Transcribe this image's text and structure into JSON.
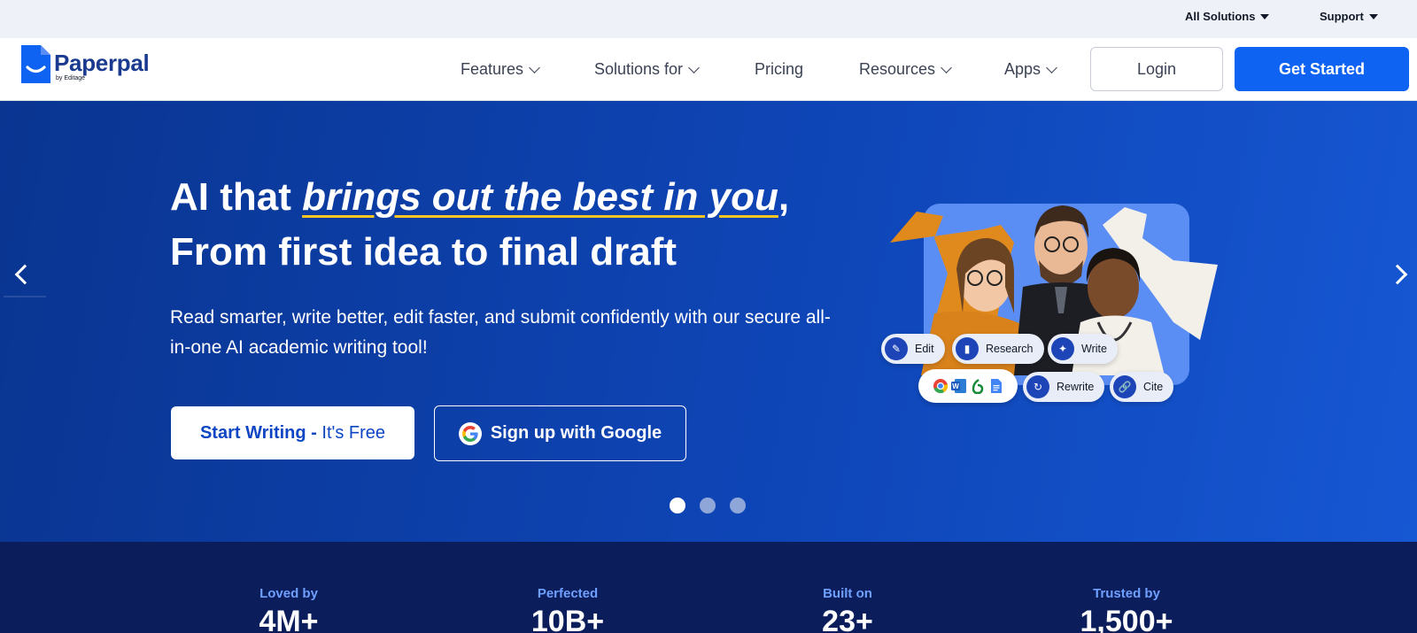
{
  "topbar": {
    "all_solutions": "All Solutions",
    "support": "Support"
  },
  "brand": {
    "name": "Paperpal",
    "byline": "by Editage",
    "color": "#1a3a8f"
  },
  "nav": {
    "items": [
      {
        "label": "Features",
        "has_dropdown": true
      },
      {
        "label": "Solutions for",
        "has_dropdown": true
      },
      {
        "label": "Pricing",
        "has_dropdown": false
      },
      {
        "label": "Resources",
        "has_dropdown": true
      },
      {
        "label": "Apps",
        "has_dropdown": true
      }
    ],
    "login_label": "Login",
    "get_started_label": "Get Started"
  },
  "hero": {
    "headline_prefix": "AI that ",
    "headline_emphasis": "brings out the best in you",
    "headline_suffix": ",",
    "headline_line2": "From first idea to final draft",
    "subtext": "Read smarter, write better, edit faster, and submit confidently with our secure all-in-one AI academic writing tool!",
    "cta_primary_main": "Start Writing - ",
    "cta_primary_free": "It's Free",
    "cta_google": "Sign up with Google",
    "carousel": {
      "total_slides": 3,
      "active_slide": 1
    },
    "features": {
      "edit": "Edit",
      "research": "Research",
      "write": "Write",
      "rewrite": "Rewrite",
      "cite": "Cite"
    },
    "integrations": [
      "chrome-icon",
      "word-icon",
      "overleaf-icon",
      "google-docs-icon"
    ]
  },
  "stats": [
    {
      "label": "Loved by",
      "value": "4M+"
    },
    {
      "label": "Perfected",
      "value": "10B+"
    },
    {
      "label": "Built on",
      "value": "23+"
    },
    {
      "label": "Trusted by",
      "value": "1,500+"
    }
  ],
  "colors": {
    "accent": "#0e63f2",
    "hero_bg": "#0e45b6",
    "underline": "#f7c623",
    "stats_bg": "#0b1d5a"
  }
}
